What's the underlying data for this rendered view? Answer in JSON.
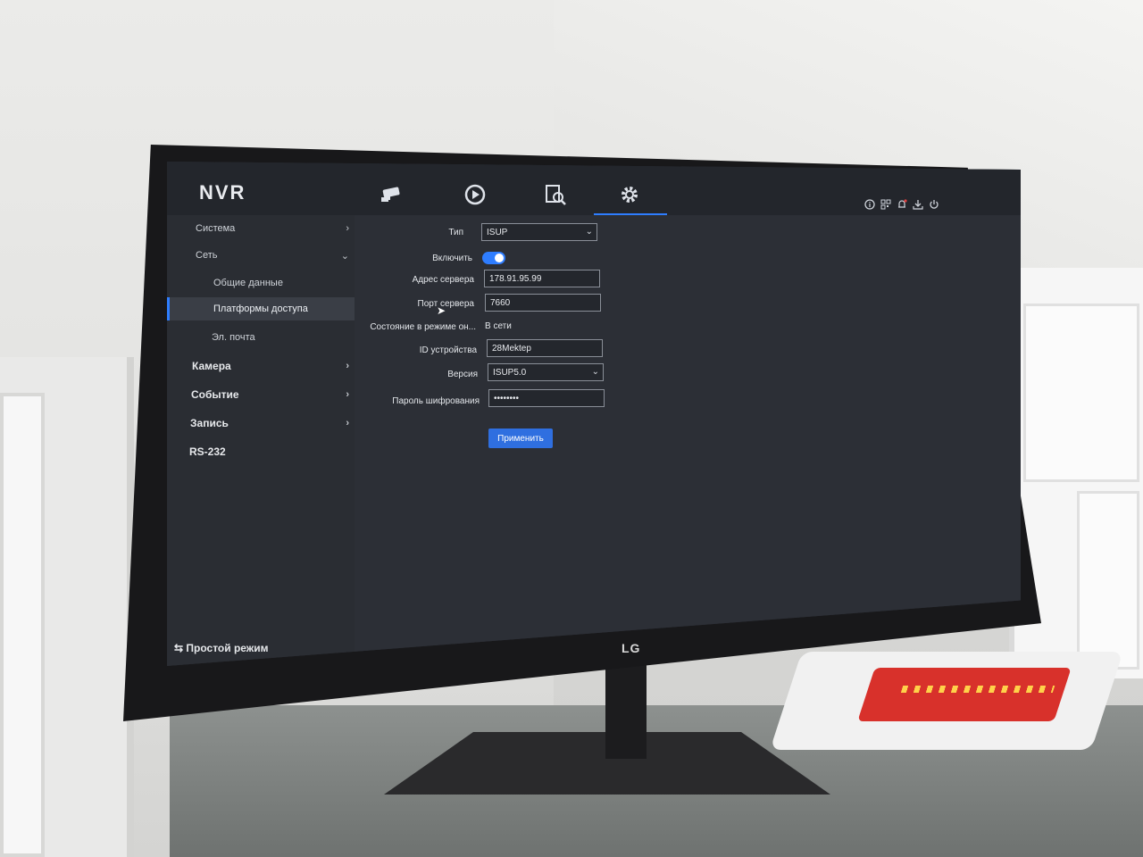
{
  "app": {
    "logo": "NVR"
  },
  "topnav": {
    "icons": [
      "camera-icon",
      "playback-icon",
      "search-icon",
      "settings-icon"
    ],
    "active_index": 3
  },
  "status_icons": [
    "info-icon",
    "qr-icon",
    "alarm-icon",
    "download-icon",
    "power-icon"
  ],
  "sidebar": {
    "items": [
      {
        "label": "Система",
        "expandable": true
      },
      {
        "label": "Сеть",
        "expanded": true
      },
      {
        "label": "Общие данные"
      },
      {
        "label": "Платформы доступа",
        "active": true
      },
      {
        "label": "Эл. почта"
      },
      {
        "label": "Камера",
        "expandable": true
      },
      {
        "label": "Событие",
        "expandable": true
      },
      {
        "label": "Запись",
        "expandable": true
      },
      {
        "label": "RS-232"
      }
    ],
    "simple_mode": "⇆ Простой режим"
  },
  "form": {
    "type_label": "Тип",
    "type_value": "ISUP",
    "enable_label": "Включить",
    "enable_value": true,
    "server_address_label": "Адрес сервера",
    "server_address_value": "178.91.95.99",
    "server_port_label": "Порт сервера",
    "server_port_value": "7660",
    "online_state_label": "Состояние в режиме он...",
    "online_state_value": "В сети",
    "device_id_label": "ID устройства",
    "device_id_value": "28Mektep",
    "version_label": "Версия",
    "version_value": "ISUP5.0",
    "encryption_password_label": "Пароль шифрования",
    "encryption_password_value": "••••••••",
    "apply_label": "Применить"
  },
  "monitor": {
    "brand": "LG"
  },
  "colors": {
    "accent": "#2e7dff",
    "screen_bg": "#2c2f36",
    "sidebar_bg": "#2a2d33",
    "topbar_bg": "#23262c"
  }
}
